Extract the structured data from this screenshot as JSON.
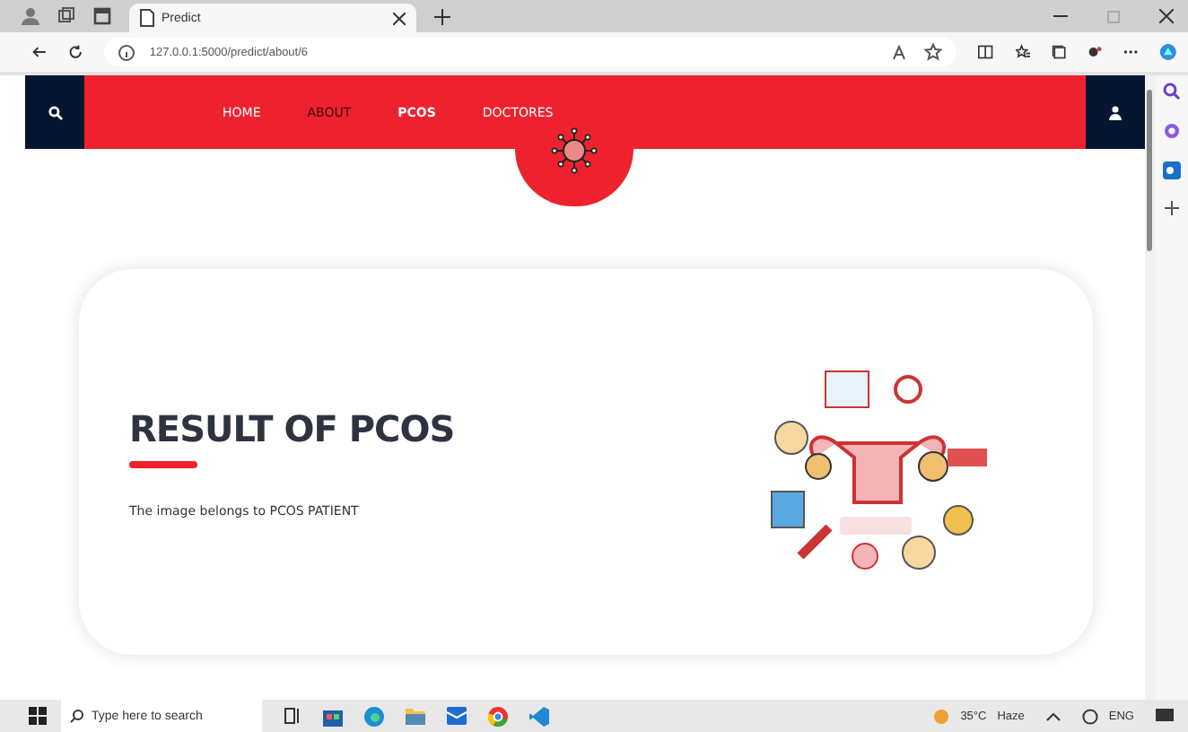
{
  "browser": {
    "tab_title": "Predict",
    "url": "127.0.0.1:5000/predict/about/6"
  },
  "nav": {
    "items": [
      {
        "label": "HOME",
        "selected": false,
        "highlighted": false
      },
      {
        "label": "ABOUT",
        "selected": false,
        "highlighted": true
      },
      {
        "label": "PCOS",
        "selected": true,
        "highlighted": false
      },
      {
        "label": "DOCTORES",
        "selected": false,
        "highlighted": false
      }
    ]
  },
  "result": {
    "title": "RESULT OF PCOS",
    "message": "The image belongs to PCOS PATIENT"
  },
  "taskbar": {
    "search_placeholder": "Type here to search",
    "weather_temp": "35°C",
    "weather_text": "Haze",
    "language": "ENG"
  }
}
